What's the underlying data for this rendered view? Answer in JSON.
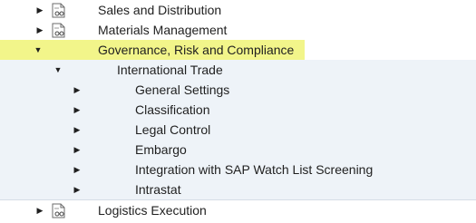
{
  "tree": {
    "items": [
      {
        "label": "Sales and Distribution",
        "state": "collapsed",
        "icon": "document-glasses-icon"
      },
      {
        "label": "Materials Management",
        "state": "collapsed",
        "icon": "document-glasses-icon"
      },
      {
        "label": "Governance, Risk and Compliance",
        "state": "expanded",
        "highlighted": true
      },
      {
        "label": "International Trade",
        "state": "expanded"
      },
      {
        "label": "General Settings",
        "state": "collapsed"
      },
      {
        "label": "Classification",
        "state": "collapsed"
      },
      {
        "label": "Legal Control",
        "state": "collapsed"
      },
      {
        "label": "Embargo",
        "state": "collapsed"
      },
      {
        "label": "Integration with SAP Watch List Screening",
        "state": "collapsed"
      },
      {
        "label": "Intrastat",
        "state": "collapsed"
      },
      {
        "label": "Logistics Execution",
        "state": "collapsed",
        "icon": "document-glasses-icon"
      }
    ]
  },
  "colors": {
    "highlight": "#f2f58a",
    "subtree_band": "#eef3f8",
    "separator": "#d5dde6"
  }
}
